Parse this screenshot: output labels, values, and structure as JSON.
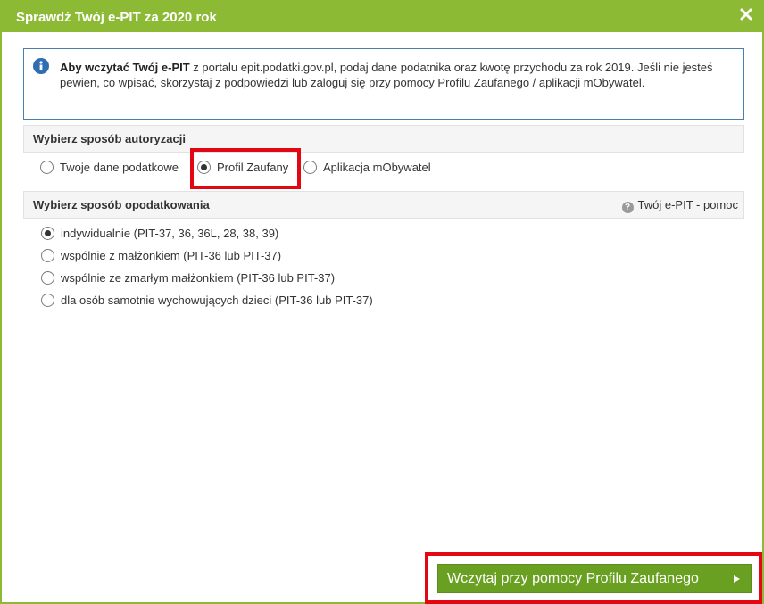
{
  "dialog": {
    "title": "Sprawdź Twój e-PIT za 2020 rok",
    "close_icon": "close-icon"
  },
  "info": {
    "icon": "info-icon",
    "lead": "Aby wczytać Twój e-PIT",
    "text": " z portalu epit.podatki.gov.pl, podaj dane podatnika oraz kwotę przychodu za rok 2019. Jeśli nie jesteś pewien, co wpisać, skorzystaj z podpowiedzi lub zaloguj się przy pomocy Profilu Zaufanego / aplikacji mObywatel."
  },
  "auth": {
    "title": "Wybierz sposób autoryzacji",
    "options": [
      {
        "label": "Twoje dane podatkowe",
        "selected": false
      },
      {
        "label": "Profil Zaufany",
        "selected": true
      },
      {
        "label": "Aplikacja mObywatel",
        "selected": false
      }
    ]
  },
  "taxation": {
    "title": "Wybierz sposób opodatkowania",
    "help_label": "Twój e-PIT - pomoc",
    "options": [
      {
        "label": "indywidualnie (PIT-37, 36, 36L, 28, 38, 39)",
        "selected": true
      },
      {
        "label": "wspólnie z małżonkiem (PIT-36 lub PIT-37)",
        "selected": false
      },
      {
        "label": "wspólnie ze zmarłym małżonkiem (PIT-36 lub PIT-37)",
        "selected": false
      },
      {
        "label": "dla osób samotnie wychowujących dzieci (PIT-36 lub PIT-37)",
        "selected": false
      }
    ]
  },
  "submit": {
    "label": "Wczytaj przy pomocy Profilu Zaufanego"
  },
  "colors": {
    "brand_green": "#8cba35",
    "button_green": "#6aa022",
    "highlight_red": "#e30613",
    "info_blue": "#2f6db5"
  }
}
